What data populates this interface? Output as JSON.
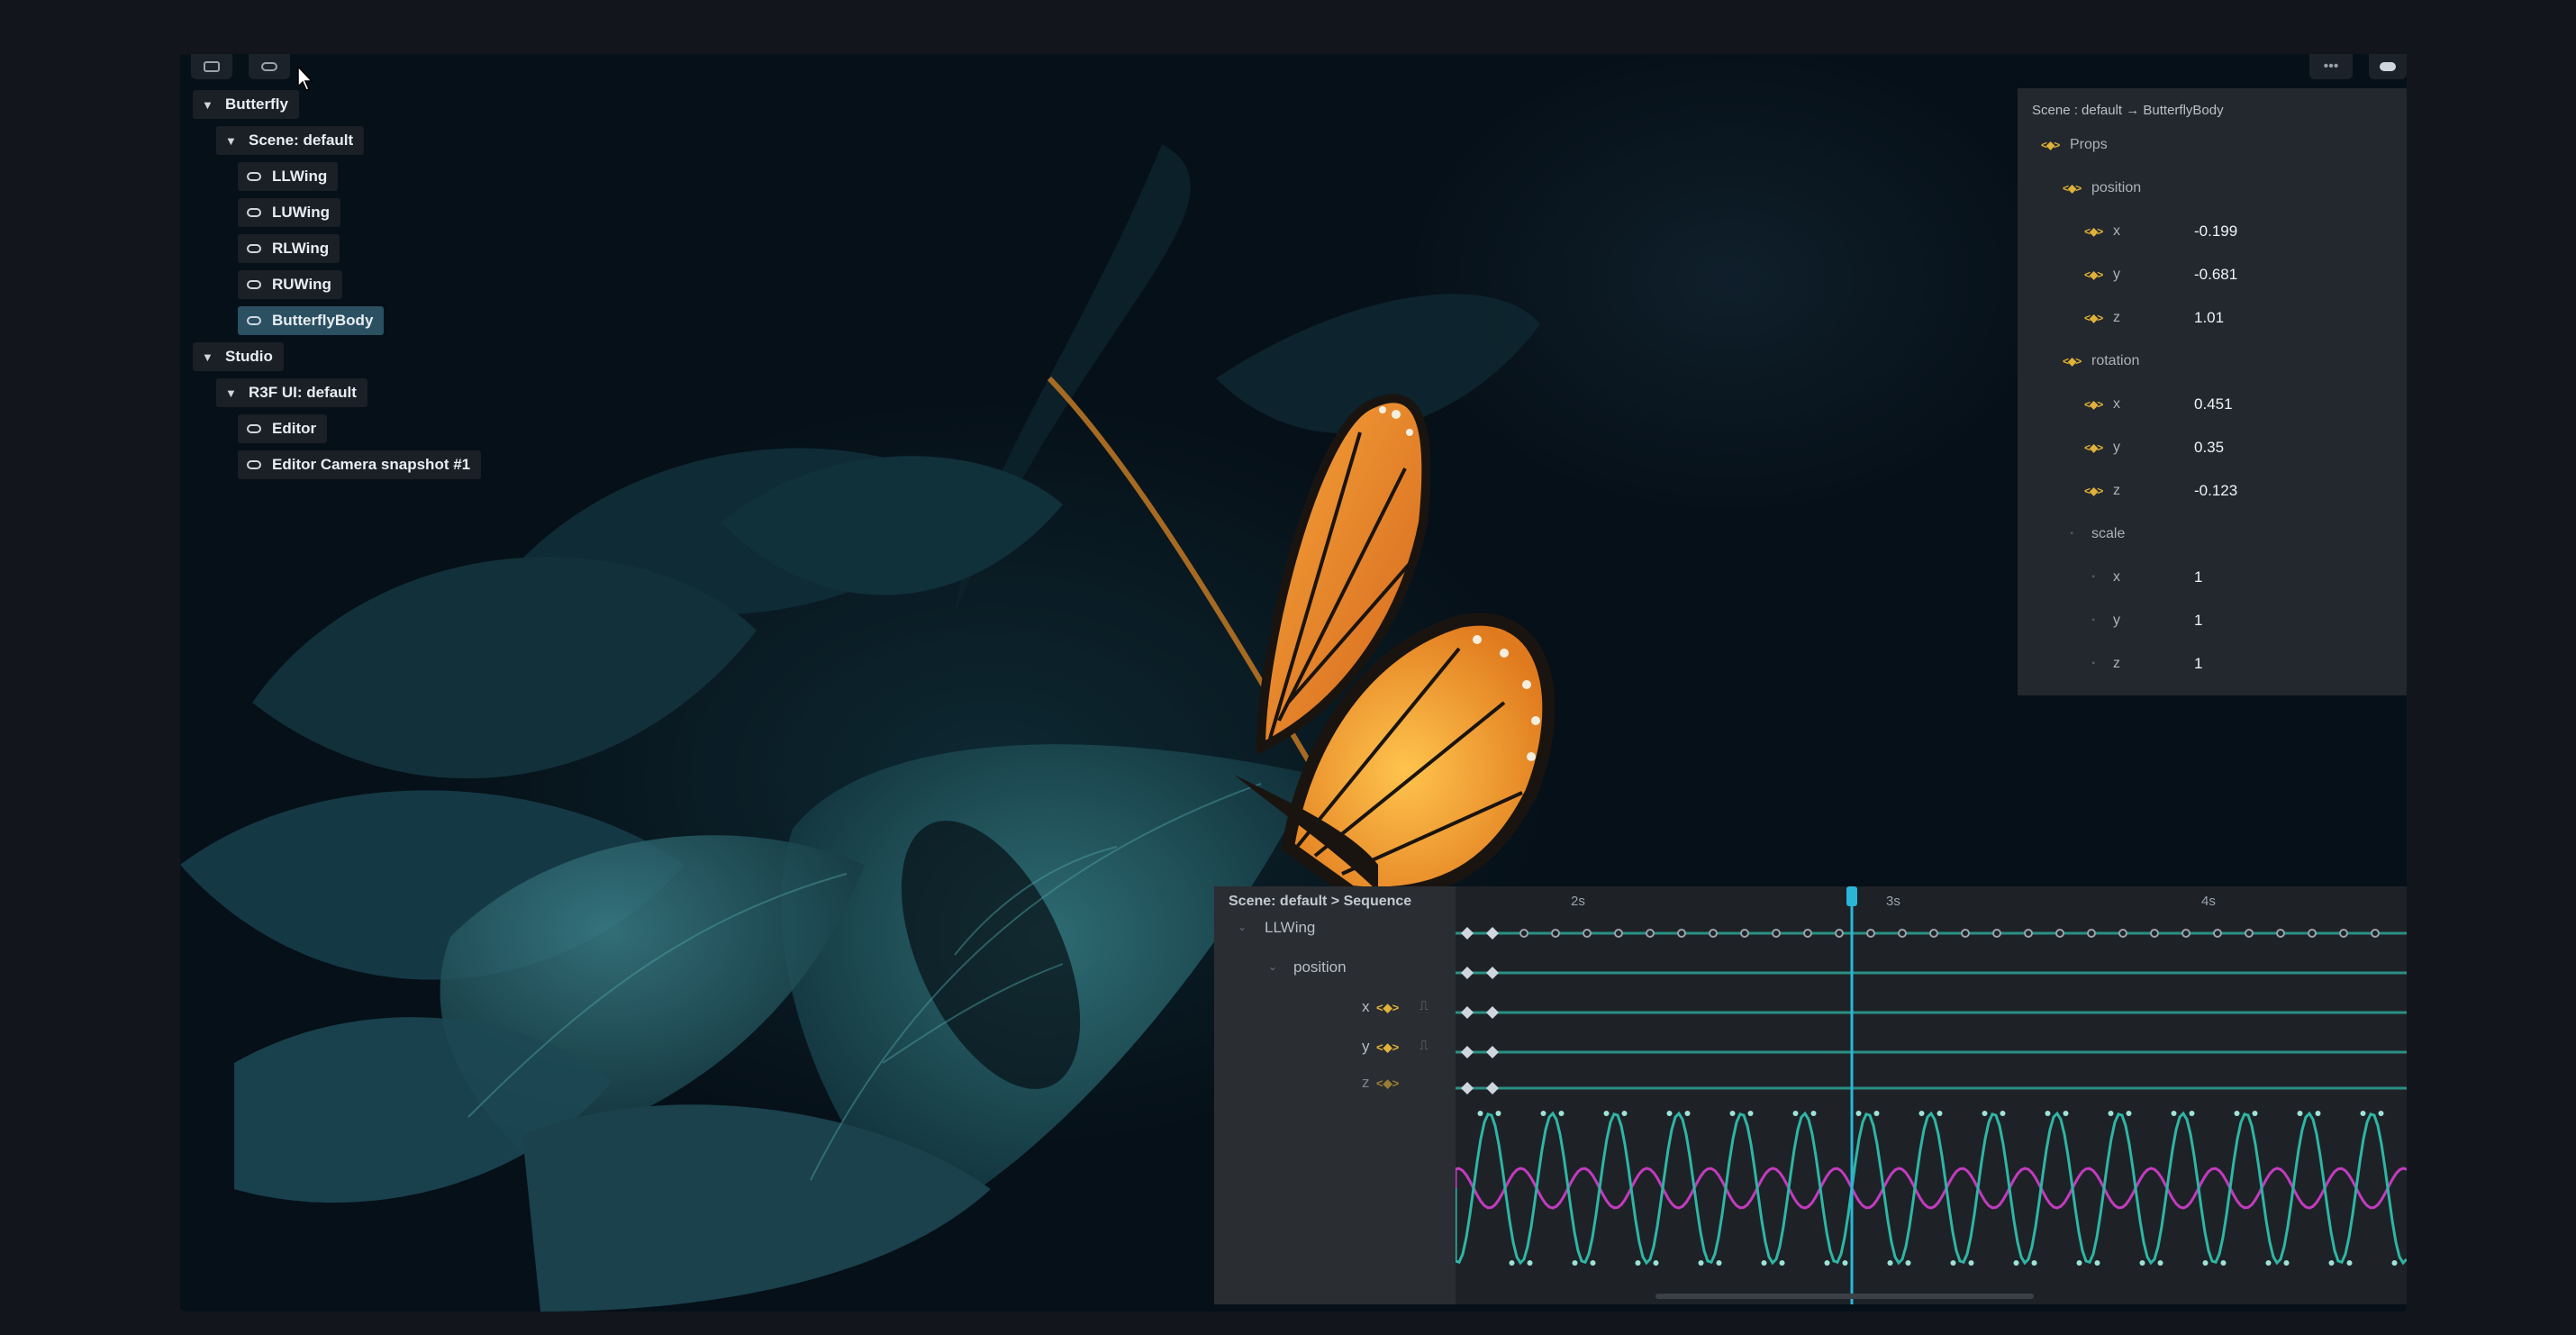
{
  "outline": {
    "items": [
      {
        "label": "Butterfly",
        "level": 0,
        "kind": "folder",
        "selected": false
      },
      {
        "label": "Scene: default",
        "level": 1,
        "kind": "folder",
        "selected": false
      },
      {
        "label": "LLWing",
        "level": 2,
        "kind": "object",
        "selected": false
      },
      {
        "label": "LUWing",
        "level": 2,
        "kind": "object",
        "selected": false
      },
      {
        "label": "RLWing",
        "level": 2,
        "kind": "object",
        "selected": false
      },
      {
        "label": "RUWing",
        "level": 2,
        "kind": "object",
        "selected": false
      },
      {
        "label": "ButterflyBody",
        "level": 2,
        "kind": "object",
        "selected": true
      },
      {
        "label": "Studio",
        "level": 0,
        "kind": "folder",
        "selected": false
      },
      {
        "label": "R3F UI: default",
        "level": 1,
        "kind": "folder",
        "selected": false
      },
      {
        "label": "Editor",
        "level": 2,
        "kind": "object",
        "selected": false
      },
      {
        "label": "Editor Camera snapshot #1",
        "level": 2,
        "kind": "object",
        "selected": false
      }
    ]
  },
  "props": {
    "breadcrumb": "Scene : default → ButterflyBody",
    "root_label": "Props",
    "position": {
      "label": "position",
      "x": "-0.199",
      "y": "-0.681",
      "z": "1.01"
    },
    "rotation": {
      "label": "rotation",
      "x": "0.451",
      "y": "0.35",
      "z": "-0.123"
    },
    "scale": {
      "label": "scale",
      "x": "1",
      "y": "1",
      "z": "1"
    },
    "axis_labels": {
      "x": "x",
      "y": "y",
      "z": "z"
    }
  },
  "sequence": {
    "breadcrumb": "Scene: default > Sequence",
    "tracks": {
      "object": "LLWing",
      "prop": "position",
      "x": "x",
      "y": "y",
      "z": "z"
    },
    "ticks": [
      "2s",
      "3s",
      "4s"
    ],
    "playhead_time": "~2.9s"
  },
  "colors": {
    "accent": "#2bb6d9",
    "keyframe_icon": "#e0b23a",
    "curve_teal": "#2fb5a5",
    "curve_magenta": "#c23bbf",
    "selected_row": "#2a5062"
  },
  "icons": {
    "tree_folder": "chevron-down-icon",
    "tree_object": "object-icon",
    "prop_keyframe": "keyframe-icon",
    "cursor": "mouse-cursor-icon"
  }
}
